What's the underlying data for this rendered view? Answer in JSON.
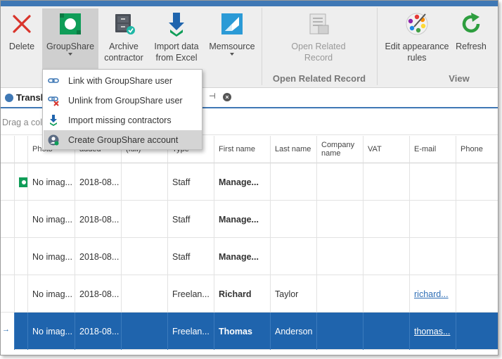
{
  "ribbon": {
    "buttons": [
      {
        "label": "Delete",
        "icon": "delete-x-icon"
      },
      {
        "label": "GroupShare",
        "icon": "groupshare-icon"
      },
      {
        "label": "Archive contractor",
        "line1": "Archive",
        "line2": "contractor",
        "icon": "archive-icon"
      },
      {
        "label": "Import data from Excel",
        "line1": "Import data",
        "line2": "from Excel",
        "icon": "import-icon"
      },
      {
        "label": "Memsource",
        "icon": "memsource-icon"
      },
      {
        "label": "Open Related Record",
        "line1": "Open Related",
        "line2": "Record",
        "icon": "open-record-icon"
      },
      {
        "label": "Edit appearance rules",
        "line1": "Edit appearance",
        "line2": "rules",
        "icon": "palette-icon"
      },
      {
        "label": "Refresh",
        "icon": "refresh-icon"
      }
    ],
    "groups": {
      "open_related": "Open Related Record",
      "view": "View"
    }
  },
  "dropdown": {
    "items": [
      {
        "label": "Link with GroupShare user",
        "icon": "link-icon"
      },
      {
        "label": "Unlink from GroupShare user",
        "icon": "unlink-icon"
      },
      {
        "label": "Import missing contractors",
        "icon": "import-down-icon"
      },
      {
        "label": "Create GroupShare account",
        "icon": "user-add-icon"
      }
    ]
  },
  "tab": {
    "label": "Transl",
    "pin": "⊣",
    "close": "×"
  },
  "group_hint": "Drag a col                                                                 n",
  "grid": {
    "headers": [
      "",
      "Photo",
      "added",
      "(full)",
      "Type",
      "First name",
      "Last name",
      "Company name",
      "VAT",
      "E-mail",
      "Phone"
    ],
    "rows": [
      {
        "photo": "No imag...",
        "date": "2018-08...",
        "type": "Staff",
        "first": "Manage...",
        "last": "",
        "company": "",
        "vat": "",
        "email": "",
        "phone": "",
        "groupshare": true,
        "selected": false
      },
      {
        "photo": "No imag...",
        "date": "2018-08...",
        "type": "Staff",
        "first": "Manage...",
        "last": "",
        "company": "",
        "vat": "",
        "email": "",
        "phone": "",
        "groupshare": false,
        "selected": false
      },
      {
        "photo": "No imag...",
        "date": "2018-08...",
        "type": "Staff",
        "first": "Manage...",
        "last": "",
        "company": "",
        "vat": "",
        "email": "",
        "phone": "",
        "groupshare": false,
        "selected": false
      },
      {
        "photo": "No imag...",
        "date": "2018-08...",
        "type": "Freelan...",
        "first": "Richard",
        "last": "Taylor",
        "company": "",
        "vat": "",
        "email": "richard...",
        "phone": "",
        "groupshare": false,
        "selected": false
      },
      {
        "photo": "No imag...",
        "date": "2018-08...",
        "type": "Freelan...",
        "first": "Thomas",
        "last": "Anderson",
        "company": "",
        "vat": "",
        "email": "thomas...",
        "phone": "",
        "groupshare": false,
        "selected": true
      }
    ]
  },
  "colors": {
    "accent": "#3f78b5",
    "selected_row": "#1f64ad",
    "groupshare_green": "#0f9d58"
  }
}
